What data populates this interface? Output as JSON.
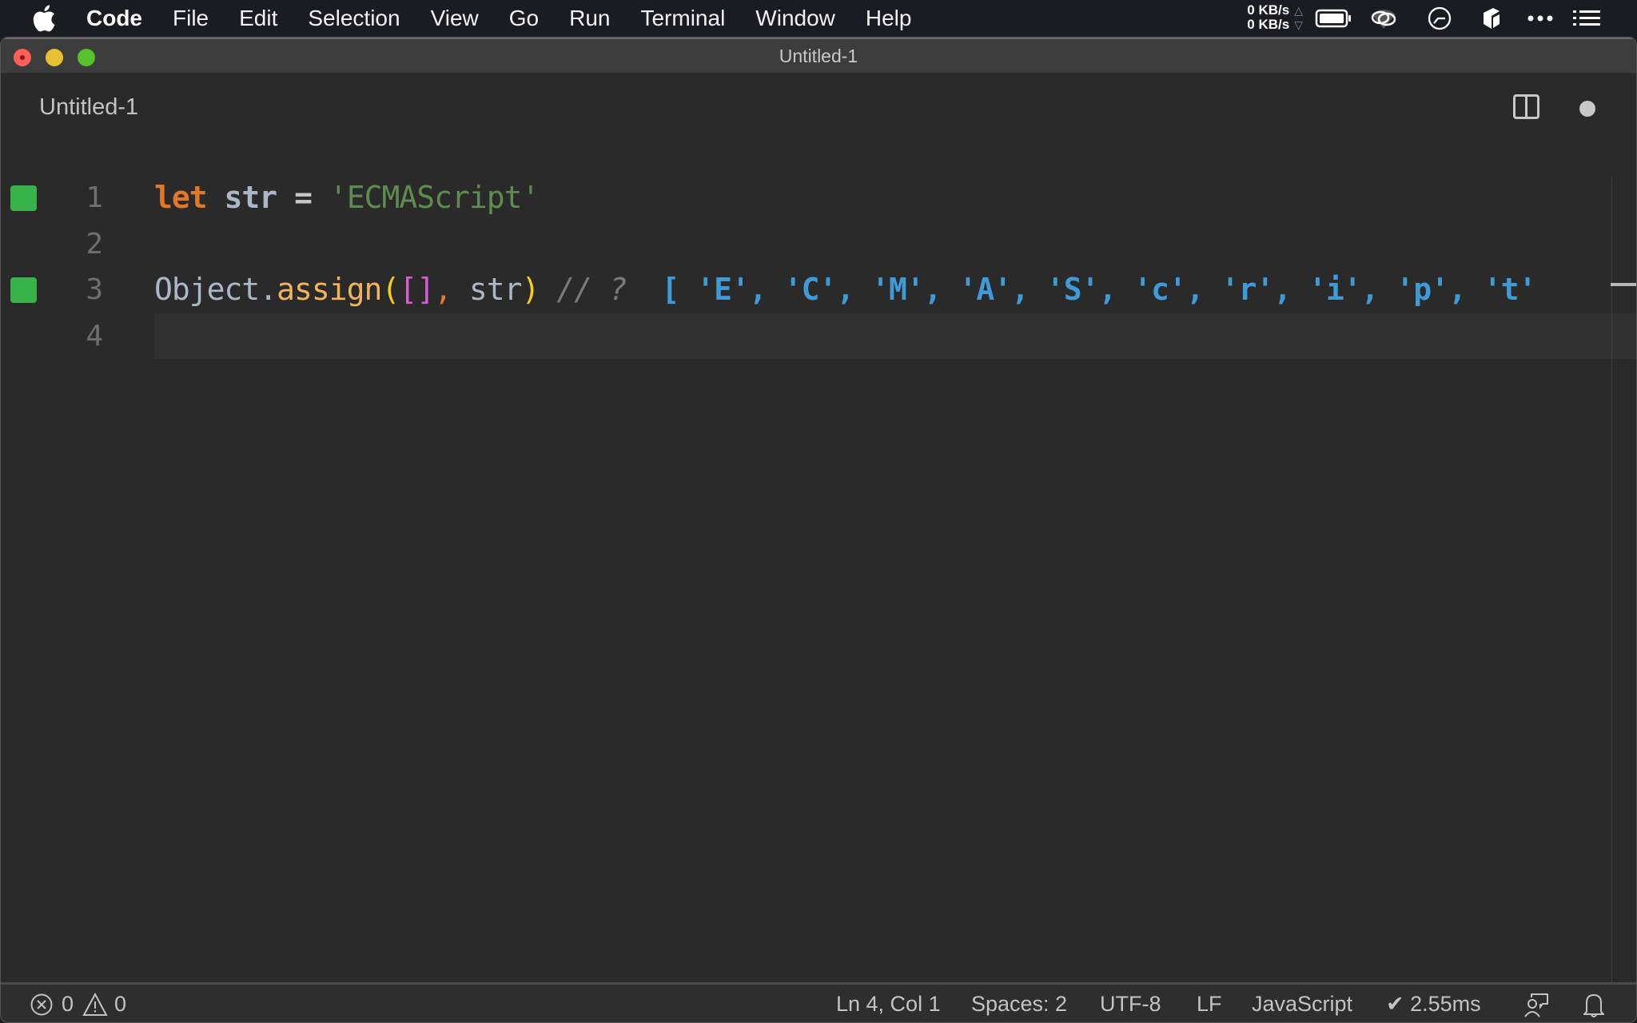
{
  "menubar": {
    "app_name": "Code",
    "items": [
      "File",
      "Edit",
      "Selection",
      "View",
      "Go",
      "Run",
      "Terminal",
      "Window",
      "Help"
    ],
    "network": {
      "upload": "0 KB/s",
      "download": "0 KB/s"
    },
    "tray_icons": [
      "battery-icon",
      "creative-cloud-icon",
      "clock-icon",
      "dropbox-icon",
      "more-icon",
      "list-icon"
    ]
  },
  "window": {
    "title": "Untitled-1"
  },
  "tabs": [
    {
      "label": "Untitled-1",
      "active": true,
      "dirty": true
    }
  ],
  "editor": {
    "lines": [
      {
        "number": "1",
        "marker": true,
        "tokens": [
          {
            "t": "let",
            "c": "kw"
          },
          {
            "t": " ",
            "c": ""
          },
          {
            "t": "str",
            "c": "var"
          },
          {
            "t": " ",
            "c": ""
          },
          {
            "t": "=",
            "c": "op"
          },
          {
            "t": " ",
            "c": ""
          },
          {
            "t": "'ECMAScript'",
            "c": "str"
          }
        ]
      },
      {
        "number": "2",
        "marker": false,
        "tokens": []
      },
      {
        "number": "3",
        "marker": true,
        "tokens": [
          {
            "t": "Object",
            "c": "obj"
          },
          {
            "t": ".",
            "c": "obj"
          },
          {
            "t": "assign",
            "c": "fn"
          },
          {
            "t": "(",
            "c": "paren"
          },
          {
            "t": "[]",
            "c": "brk"
          },
          {
            "t": ",",
            "c": "comma"
          },
          {
            "t": " str",
            "c": "obj"
          },
          {
            "t": ")",
            "c": "paren"
          },
          {
            "t": " // ?",
            "c": "cmt"
          },
          {
            "t": "  [ 'E', 'C', 'M', 'A', 'S', 'c', 'r', 'i', 'p', 't'",
            "c": "result"
          }
        ]
      },
      {
        "number": "4",
        "marker": false,
        "current": true,
        "tokens": []
      }
    ]
  },
  "statusbar": {
    "errors": "0",
    "warnings": "0",
    "cursor_position": "Ln 4, Col 1",
    "indentation": "Spaces: 2",
    "encoding": "UTF-8",
    "eol": "LF",
    "language": "JavaScript",
    "timing": "✔ 2.55ms"
  },
  "colors": {
    "gutter_marker": "#38b34a",
    "keyword": "#e0782a",
    "string": "#5e8c4f",
    "result": "#3e9bd8"
  }
}
